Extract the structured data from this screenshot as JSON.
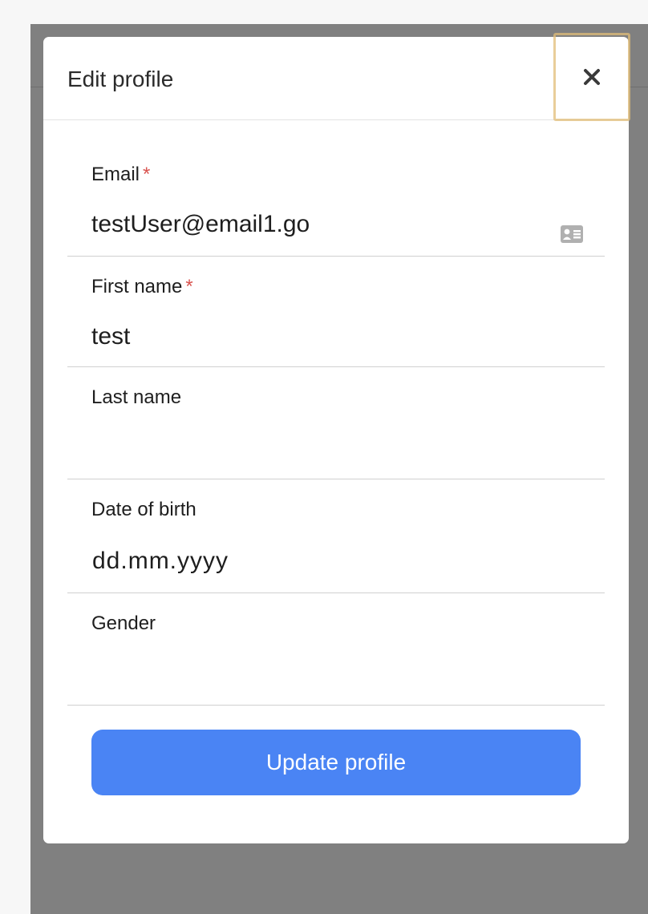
{
  "modal": {
    "title": "Edit profile",
    "close_icon": "close-icon"
  },
  "form": {
    "required_marker": "*",
    "email": {
      "label": "Email",
      "value": "testUser@email1.go",
      "required": true,
      "icon": "contact-card-icon"
    },
    "first_name": {
      "label": "First name",
      "value": "test",
      "required": true
    },
    "last_name": {
      "label": "Last name",
      "value": ""
    },
    "date_of_birth": {
      "label": "Date of birth",
      "placeholder": "dd.mm.yyyy"
    },
    "gender": {
      "label": "Gender",
      "value": ""
    }
  },
  "actions": {
    "update_label": "Update profile"
  },
  "colors": {
    "primary": "#4a84f4",
    "required": "#d9534f",
    "overlay": "#808080",
    "focus_outline": "#e2be78"
  }
}
